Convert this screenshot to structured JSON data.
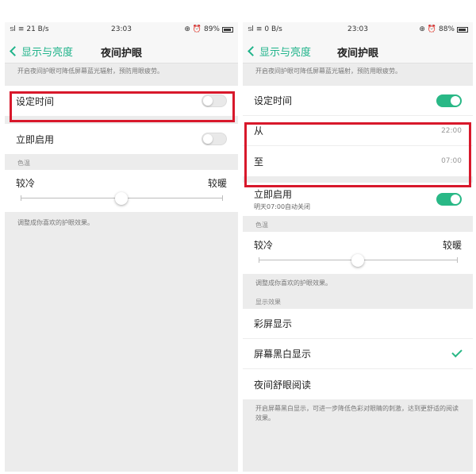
{
  "left": {
    "status": {
      "signal": "ടl",
      "wifi": "≡",
      "speed": "21 B/s",
      "time": "23:03",
      "icons": "⊕ ⏰",
      "battery": "89%"
    },
    "nav": {
      "back_label": "显示与亮度",
      "title": "夜间护眼"
    },
    "intro_note": "开启夜间护眼可降低屏幕蓝光辐射，预防用眼疲劳。",
    "schedule_label": "设定时间",
    "schedule_on": false,
    "enable_now_label": "立即启用",
    "enable_now_on": false,
    "color_temp_section": "色温",
    "cool_label": "较冷",
    "warm_label": "较暖",
    "color_temp_level": 0.5,
    "adjust_note": "调整成你喜欢的护眼效果。"
  },
  "right": {
    "status": {
      "signal": "ടl",
      "wifi": "≡",
      "speed": "0 B/s",
      "time": "23:03",
      "icons": "⊕ ⏰",
      "battery": "88%"
    },
    "nav": {
      "back_label": "显示与亮度",
      "title": "夜间护眼"
    },
    "intro_note": "开启夜间护眼可降低屏幕蓝光辐射，预防用眼疲劳。",
    "schedule_label": "设定时间",
    "schedule_on": true,
    "from_label": "从",
    "from_time": "22:00",
    "to_label": "至",
    "to_time": "07:00",
    "enable_now_label": "立即启用",
    "enable_now_sub": "明天07:00自动关闭",
    "enable_now_on": true,
    "color_temp_section": "色温",
    "cool_label": "较冷",
    "warm_label": "较暖",
    "color_temp_level": 0.5,
    "adjust_note": "调整成你喜欢的护眼效果。",
    "display_effect_section": "显示效果",
    "effects": [
      {
        "label": "彩屏显示",
        "selected": false
      },
      {
        "label": "屏幕黑白显示",
        "selected": true
      },
      {
        "label": "夜间舒眼阅读",
        "selected": false
      }
    ],
    "effect_note": "开启屏幕黑白显示，可进一步降低色彩对眼睛的刺激，达到更舒适的阅读效果。"
  },
  "colors": {
    "accent": "#1fb38a",
    "toggle_on": "#29b886",
    "highlight": "#d8182b"
  }
}
